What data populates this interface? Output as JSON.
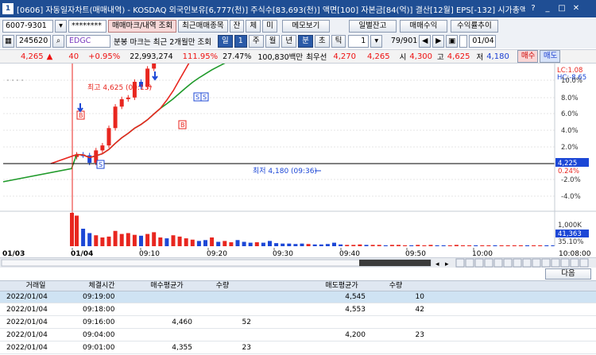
{
  "window": {
    "app_icon": "1",
    "title": "[0606] 자동일자차트(매매내역) - KOSDAQ 외국인보유[6,777(천)] 주식수[83,693(천)] 액면[100] 자본금[84(억)] 결산[12월] EPS[-132] 시가총액[",
    "buttons": [
      "?",
      "_",
      "□",
      "✕"
    ]
  },
  "toolbar1": {
    "account": "6007-9301",
    "password": "********",
    "buttons": [
      "매매마크/내역 조회",
      "최근매매종목",
      "잔",
      "체",
      "미",
      "메모보기",
      "일별잔고",
      "매매수익",
      "수익률추이"
    ]
  },
  "toolbar2": {
    "code": "245620",
    "name": "EDGC",
    "note": "분봉 마크는 최근 2개월만 조회",
    "periods": [
      "일",
      "1",
      "주",
      "월",
      "년",
      "분",
      "초",
      "틱"
    ],
    "interval": "1",
    "counter": "79/901",
    "date": "01/04"
  },
  "quote": {
    "price": "4,265",
    "change": "40",
    "change_pct": "+0.95%",
    "volume": "22,993,274",
    "vol_ratio": "111.95%",
    "turnover": "27.47%",
    "amount": "100,830백만",
    "best_label": "최우선",
    "ask": "4,270",
    "bid": "4,265",
    "open_label": "시",
    "open": "4,300",
    "high_label": "고",
    "high": "4,625",
    "low_label": "저",
    "low": "4,180",
    "buy_btn": "매수",
    "sell_btn": "매도"
  },
  "chart": {
    "right_labels": {
      "lc": "LC:1.08",
      "hc": "HC:-8.65",
      "last": "4,225",
      "last_pct": "0.24%",
      "vol_high": "1,000K",
      "vol_last": "41,363",
      "vol_pct": "35.10%"
    },
    "y_ticks": [
      "10.0%",
      "8.0%",
      "6.0%",
      "4.0%",
      "2.0%",
      "-2.0%",
      "-4.0%"
    ],
    "high_annotation": "최고 4,625 (09:13)",
    "low_annotation": "최저 4,180 (09:36)",
    "x_labels": [
      "01/04",
      "09:10",
      "09:20",
      "09:30",
      "09:40",
      "09:50",
      "10:00"
    ],
    "x_left": "01/03",
    "x_right": "10:08:00",
    "colors": {
      "up": "#e8261f",
      "down": "#1c47d6",
      "ma_short": "#e8261f",
      "ma_long": "#1f9a2a",
      "vol_up": "#e8261f",
      "vol_down": "#1c47d6"
    }
  },
  "next_button": "다음",
  "table": {
    "headers": [
      "거래일",
      "체결시간",
      "매수평균가",
      "수량",
      "매도평균가",
      "수량"
    ],
    "rows": [
      {
        "date": "2022/01/04",
        "time": "09:19:00",
        "buy_avg": "",
        "buy_qty": "",
        "sell_avg": "4,545",
        "sell_qty": "10"
      },
      {
        "date": "2022/01/04",
        "time": "09:18:00",
        "buy_avg": "",
        "buy_qty": "",
        "sell_avg": "4,553",
        "sell_qty": "42"
      },
      {
        "date": "2022/01/04",
        "time": "09:16:00",
        "buy_avg": "4,460",
        "buy_qty": "52",
        "sell_avg": "",
        "sell_qty": ""
      },
      {
        "date": "2022/01/04",
        "time": "09:04:00",
        "buy_avg": "",
        "buy_qty": "",
        "sell_avg": "4,200",
        "sell_qty": "23"
      },
      {
        "date": "2022/01/04",
        "time": "09:01:00",
        "buy_avg": "4,355",
        "buy_qty": "23",
        "sell_avg": "",
        "sell_qty": ""
      }
    ]
  }
}
